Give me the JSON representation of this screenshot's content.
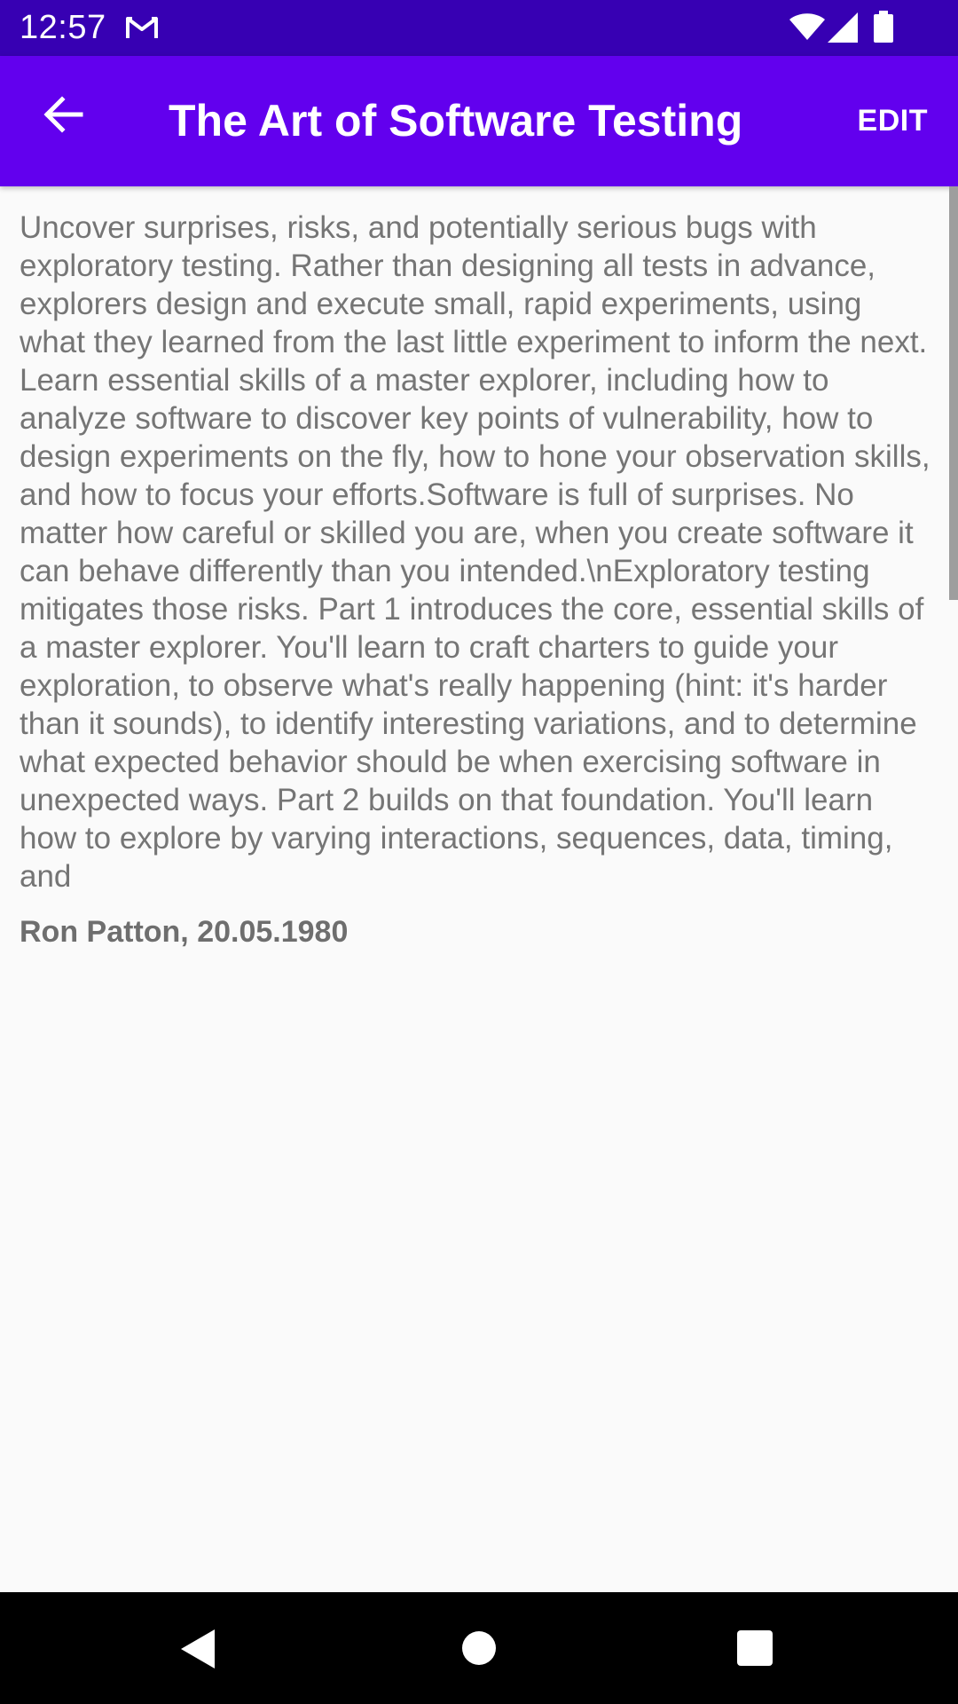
{
  "status_bar": {
    "time": "12:57",
    "icons": [
      "gmail-icon",
      "wifi-icon",
      "signal-icon",
      "battery-icon"
    ]
  },
  "app_bar": {
    "title": "The Art of Software Testing",
    "edit_label": "EDIT",
    "back_icon": "arrow-back-icon",
    "background_color": "#6200ee"
  },
  "book": {
    "description": "Uncover surprises, risks, and potentially serious bugs with exploratory testing. Rather than designing all tests in advance, explorers design and execute small, rapid experiments, using what they learned from the last little experiment to inform the next. Learn essential skills of a master explorer, including how to analyze software to discover key points of vulnerability, how to design experiments on the fly, how to hone your observation skills, and how to focus your efforts.Software is full of surprises. No matter how careful or skilled you are, when you create software it can behave differently than you intended.\\nExploratory testing mitigates those risks. Part 1 introduces the core, essential skills of a master explorer. You'll learn to craft charters to guide your exploration, to observe what's really happening (hint: it's harder than it sounds), to identify interesting variations, and to determine what expected behavior should be when exercising software in unexpected ways. Part 2 builds on that foundation. You'll learn how to explore by varying interactions, sequences, data, timing, and",
    "author_date": "Ron Patton, 20.05.1980"
  },
  "nav_bar": {
    "icons": [
      "nav-back-icon",
      "nav-home-icon",
      "nav-recents-icon"
    ]
  },
  "colors": {
    "status_bar": "#3700b3",
    "app_bar": "#6200ee",
    "text_secondary": "#757575",
    "background": "#fafafa"
  }
}
